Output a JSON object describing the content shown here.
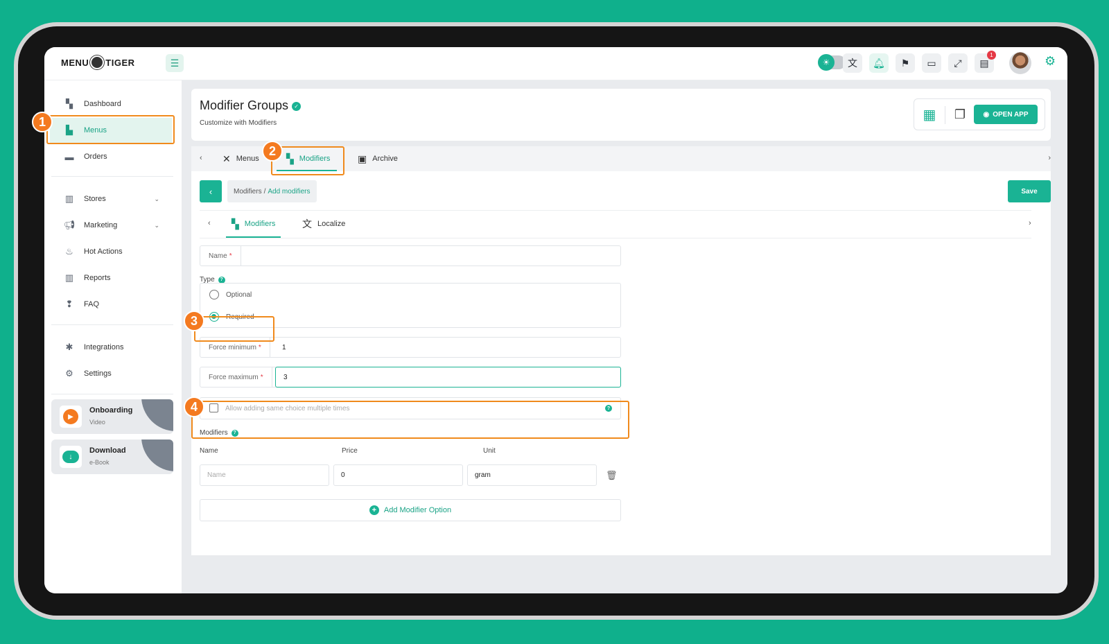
{
  "app": {
    "logo_left": "MENU",
    "logo_right": "TIGER",
    "notification_count": "1"
  },
  "topbar": {
    "icons": [
      "hamburger-icon",
      "theme-toggle",
      "translate-icon",
      "bell-icon",
      "flag-icon",
      "devices-icon",
      "fullscreen-icon",
      "orders-icon",
      "avatar",
      "gear-icon"
    ]
  },
  "sidebar": {
    "items": [
      {
        "label": "Dashboard"
      },
      {
        "label": "Menus"
      },
      {
        "label": "Orders"
      },
      {
        "label": "Stores"
      },
      {
        "label": "Marketing"
      },
      {
        "label": "Hot Actions"
      },
      {
        "label": "Reports"
      },
      {
        "label": "FAQ"
      },
      {
        "label": "Integrations"
      },
      {
        "label": "Settings"
      }
    ],
    "promos": [
      {
        "title": "Onboarding",
        "subtitle": "Video"
      },
      {
        "title": "Download",
        "subtitle": "e-Book"
      }
    ]
  },
  "header": {
    "title": "Modifier Groups",
    "subtitle": "Customize with Modifiers",
    "open_app": "OPEN APP"
  },
  "tabs": [
    {
      "label": "Menus"
    },
    {
      "label": "Modifiers"
    },
    {
      "label": "Archive"
    }
  ],
  "breadcrumb": {
    "parent": "Modifiers",
    "separator": "/",
    "current": "Add modifiers"
  },
  "save_label": "Save",
  "subtabs": [
    {
      "label": "Modifiers"
    },
    {
      "label": "Localize"
    }
  ],
  "form": {
    "name_label": "Name",
    "required_mark": "*",
    "type_label": "Type",
    "type_options": [
      "Optional",
      "Required"
    ],
    "type_selected": "Required",
    "force_min_label": "Force minimum",
    "force_min_value": "1",
    "force_max_label": "Force maximum",
    "force_max_value": "3",
    "allow_same_choice": "Allow adding same choice multiple times",
    "allow_same_choice_checked": false,
    "modifiers_label": "Modifiers",
    "columns": [
      "Name",
      "Price",
      "Unit"
    ],
    "row": {
      "name_placeholder": "Name",
      "price": "0",
      "unit": "gram"
    },
    "add_option": "Add Modifier Option"
  },
  "callouts": [
    "1",
    "2",
    "3",
    "4"
  ],
  "colors": {
    "background": "#0fb08c",
    "accent": "#1ab394",
    "callout": "#f47a20",
    "danger": "#e53945"
  }
}
